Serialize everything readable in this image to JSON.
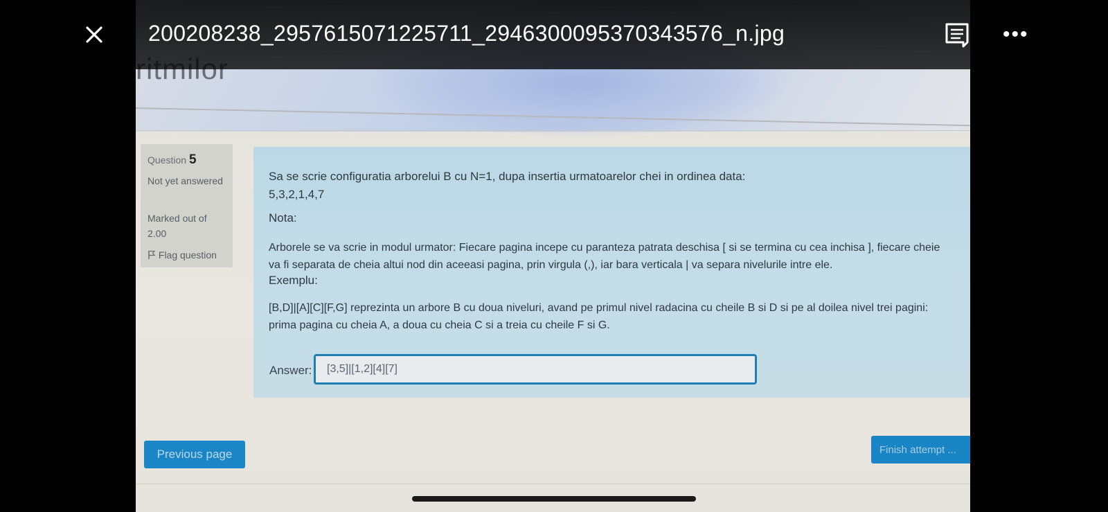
{
  "viewer": {
    "filename": "200208238_2957615071225711_2946300095370343576_n.jpg",
    "close_icon": "close-icon",
    "comment_icon": "comment-icon",
    "more_icon": "more-horizontal-icon",
    "more_glyph": "•••"
  },
  "page": {
    "banner_text": "ritmilor"
  },
  "question_info": {
    "label": "Question",
    "number": "5",
    "status": "Not yet answered",
    "marks": "Marked out of 2.00",
    "flag_label": "Flag question",
    "flag_icon": "flag-icon"
  },
  "question": {
    "text": "Sa se scrie configuratia arborelui B cu N=1, dupa insertia urmatoarelor chei in ordinea data:",
    "keys": "5,3,2,1,4,7",
    "nota_label": "Nota:",
    "description": "Arborele se va scrie in modul urmator: Fiecare pagina incepe cu paranteza patrata deschisa [ si se termina cu cea inchisa ], fiecare cheie va fi separata de cheia altui nod din aceeasi pagina, prin virgula (,), iar bara verticala | va separa nivelurile intre ele.",
    "example_label": "Exemplu:",
    "example_text": "[B,D]|[A][C][F,G] reprezinta un arbore B cu doua niveluri, avand pe primul nivel radacina cu cheile B si D si pe al doilea nivel trei pagini: prima pagina cu cheia A, a doua cu cheia C si a treia cu cheile F si G.",
    "answer_label": "Answer:",
    "answer_value": "[3,5]|[1,2][4][7]"
  },
  "navigation": {
    "previous_label": "Previous page",
    "finish_label": "Finish attempt ..."
  },
  "colors": {
    "accent": "#1b86c6",
    "question_bg": "#c4dde8",
    "info_bg": "#d3d3ce"
  }
}
